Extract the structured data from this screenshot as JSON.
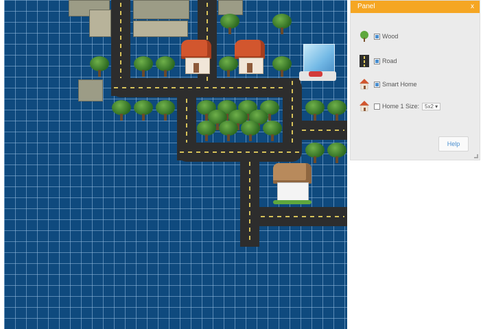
{
  "board": {
    "background": "#0f4a7e"
  },
  "panel": {
    "title": "Panel",
    "close_label": "x",
    "header_color": "#f5a623",
    "items": [
      {
        "icon": "tree-icon",
        "label": "Wood",
        "checked": true
      },
      {
        "icon": "road-icon",
        "label": "Road",
        "checked": true
      },
      {
        "icon": "house-icon",
        "label": "Smart Home",
        "checked": true
      },
      {
        "icon": "house-icon",
        "label": "Home 1 Size:",
        "checked": false,
        "size_value": "5x2"
      }
    ],
    "help_label": "Help"
  }
}
